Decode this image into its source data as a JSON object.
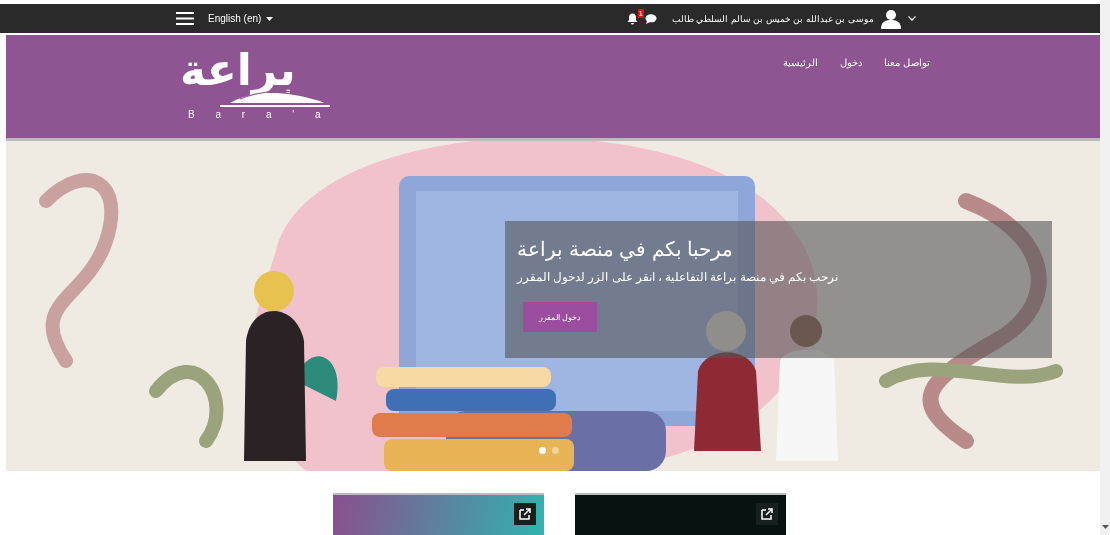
{
  "top_bar": {
    "language": "English (en)",
    "notification_count": "1",
    "user_name": "موسى بن عبدالله بن خميس بن سالم السلطي طالب"
  },
  "header": {
    "logo_text": "براعة",
    "logo_caption": "B a r a ' a",
    "nav": [
      {
        "label": "تواصل معنا"
      },
      {
        "label": "دخول"
      },
      {
        "label": "الرئيسية"
      }
    ]
  },
  "slide": {
    "kind": "picture",
    "title": "مرحبا بكم في منصة براعة",
    "text": "نرحب بكم في منصة براعة التفاعلية ، انقر على الزر لدخول المقرر",
    "button": "دخول المقرر",
    "indicators": [
      {
        "selected": true
      },
      {
        "selected": false
      }
    ]
  },
  "cards": [
    {
      "kind": "gradient"
    },
    {
      "kind": "dark"
    }
  ]
}
